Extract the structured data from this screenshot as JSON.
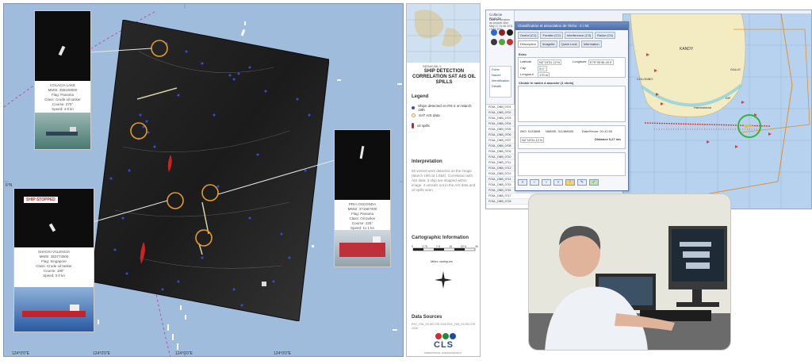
{
  "map": {
    "coord_ticks_top": [
      "",
      "",
      "",
      ""
    ],
    "coord_bottom": [
      "124°0'0\"E",
      "124°0'0\"E",
      "124°0'0\"E",
      "124°0'0\"E"
    ],
    "coord_left": [
      "6°N",
      "6°N"
    ],
    "insets": [
      {
        "id": "colacia",
        "tag": "",
        "lines": [
          "COLACIA LAKE",
          "MMSI: 356100000",
          "Flag: Panama",
          "Class: Crude oil tanker",
          "Course: 270°",
          "Speed: 4.9 kn"
        ]
      },
      {
        "id": "stopped",
        "tag": "SHIP STOPPED",
        "lines": [
          "SHAOXI VALENCIA",
          "MMSI: 353773000",
          "Flag: Singapore",
          "Class: Crude oil tanker",
          "Course: 180°",
          "Speed: 0.0 kn"
        ]
      },
      {
        "id": "right",
        "tag": "",
        "lines": [
          "PRIA OSCONDA",
          "MMSI: 371587000",
          "Flag: Panama",
          "Class: Oil tanker",
          "Course: 225°",
          "Speed: 11.1 kn"
        ]
      }
    ]
  },
  "legend": {
    "top_box": "SEIMIC/ML II",
    "title": "SHIP DETECTION CORRELATION SAT AIS OIL SPILLS",
    "legend_heading": "Legend",
    "items": [
      {
        "label": "Ships detected on RS-2 on March 19th",
        "color": "#2f4fd8"
      },
      {
        "label": "SAT AIS data",
        "color": "#e9a33a"
      },
      {
        "label": "oil spills",
        "color": "#d32020"
      }
    ],
    "interp_heading": "Interpretation",
    "interp_text": "50 vessel were detected on the image (March 19th at 1.59Z). Correlation with AIS data: 3 ship are stopped within image. 4 vessels not in the AIS data and oil spills seen.",
    "carto_heading": "Cartographic Information",
    "scale_label": "Miles nautiques",
    "scale_ticks": [
      "0",
      "3.75",
      "7.5",
      "15",
      "22.5",
      "30"
    ],
    "sources_heading": "Data Sources",
    "sources_text": "RSC_F65_S3-SECOR 2008 RSC_F65_S3-SECOR 2008",
    "logo": "CLS",
    "logo_sub": "OPERATIONAL OCEANOGRAPHY"
  },
  "app": {
    "window_title": "Collecte Rapidis",
    "window_subtitle": "Date de livraison du produit: Mon May 17 21:46 2011 / SAT 2011",
    "dialog_title": "Classification et association de l'écho : 4 / 93",
    "tabs": [
      "Description",
      "Imagette",
      "Quick Look",
      "Information"
    ],
    "alert_tabs": [
      "Ocelot (C1)",
      "Foraller (C2)",
      "Interférence (C3)",
      "Radar (C4)"
    ],
    "section_echo": "Echo",
    "fields": [
      {
        "label": "Latitude",
        "value": "N2°19'31.12 N"
      },
      {
        "label": "Longitude",
        "value": "E79°05'36.40 E"
      },
      {
        "label": "Distance",
        "value": ""
      },
      {
        "label": "Cap",
        "value": "0.0 °"
      },
      {
        "label": "Longueur",
        "value": "170 m"
      }
    ],
    "section_assoc": "Choisir le navire à associer (1 choix)",
    "assoc_row": [
      "IMO: 5133808",
      "NMMSI: 311388000",
      "Date/Heure: 01:42:00"
    ],
    "dist_label": "Distance 0,27 nm",
    "sidebar_items": [
      "Fiche",
      "Navire",
      "Identification",
      "Détails"
    ],
    "list_rows": [
      "FOUL_DNB_0701",
      "FOUL_DNB_0702",
      "FOUL_DNB_0703",
      "FOUL_DNB_0704",
      "FOUL_DNB_0705",
      "FOUL_DNB_0706",
      "FOUL_DNB_0707",
      "FOUL_DNB_0708",
      "FOUL_DNB_0709",
      "FOUL_DNB_0710",
      "FOUL_DNB_0711",
      "FOUL_DNB_0712",
      "FOUL_DNB_0713",
      "FOUL_DNB_0714",
      "FOUL_DNB_0715",
      "FOUL_DNB_0716",
      "FOUL_DNB_0717",
      "FOUL_DNB_0718"
    ],
    "map_labels": [
      "KANDY",
      "COLOMBO",
      "GALLE",
      "Hambantota",
      "DIF"
    ]
  },
  "colors": {
    "sea": "#9fbcdc",
    "ring": "#e69b22",
    "detections": "#2f4fd8",
    "spill": "#d32020",
    "app_sea": "#b6d2ee",
    "land": "#f3ecc2",
    "track": "#e23a2a",
    "boundary": "#e3902a",
    "highlight": "#32b43c"
  }
}
